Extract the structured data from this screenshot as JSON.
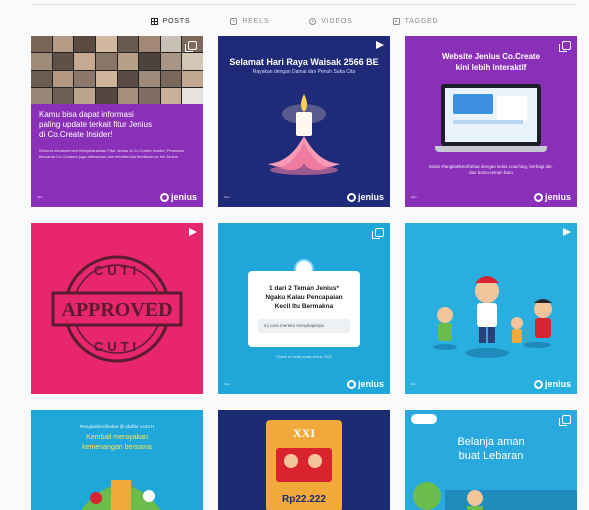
{
  "tabs": [
    {
      "label": "POSTS",
      "icon": "grid-icon",
      "active": true
    },
    {
      "label": "REELS",
      "icon": "reels-icon",
      "active": false
    },
    {
      "label": "VIDEOS",
      "icon": "video-icon",
      "active": false
    },
    {
      "label": "TAGGED",
      "icon": "tag-icon",
      "active": false
    }
  ],
  "posts": [
    {
      "bg": "#8a2fb8",
      "lines": [
        "Kamu bisa dapat informasi",
        "paling update terkait fitur Jenius",
        "di Co.Create Insider!"
      ],
      "subtext": "Seluruh enhancement Menyelaraskan Fitur Jenius di Co.Create Insider, Perasaan Bersama Co.Creators juga diterapkan dan membentuk feedback ke tim Jenius.",
      "brand": "jenius",
      "badge": "multi"
    },
    {
      "bg": "#1f2a78",
      "title": "Selamat Hari Raya Waisak 2566 BE",
      "subtitle": "Rayakan dengan Damai dan Penuh Suka Cita",
      "brand": "jenius",
      "badge": "reel"
    },
    {
      "bg": "#8a2fb8",
      "title": "Website Jenius Co.Create",
      "title2": "kini lebih interaktif",
      "caption": "Mulai #langkahkecilhebat dengan kelas coaching, berbagi ide, dan bantu teman baru",
      "brand": "jenius",
      "badge": "multi"
    },
    {
      "bg": "#e8266d",
      "stamp_top": "CUTI",
      "stamp_main": "APPROVED",
      "stamp_bottom": "CUTI",
      "badge": "reel"
    },
    {
      "bg": "#1ea7d8",
      "card_line1": "1 dari 2 Teman Jenius*",
      "card_line2": "Ngaku Kalau Pencapaian",
      "card_line3": "Kecil Itu Bermakna",
      "card_input": "Ini cara mereka menyikapinya",
      "footnote": "*Survei di media sosial Jenius, 2022",
      "brand": "jenius",
      "badge": "multi"
    },
    {
      "bg": "#29aee0",
      "brand": "jenius",
      "badge": "reel"
    },
    {
      "bg": "#1ea7d8",
      "hashtag": "#langkahkecilhebat @ Idulfitri 1443 H",
      "line1": "Kembali merayakan",
      "line2": "kemenangan bersama",
      "badge": "none"
    },
    {
      "bg": "#1b2b73",
      "top_label": "XXI",
      "price_label": "Rp22.222",
      "badge": "none"
    },
    {
      "bg": "#2aa9df",
      "line1": "Belanja aman",
      "line2": "buat Lebaran",
      "badge": "multi"
    }
  ]
}
